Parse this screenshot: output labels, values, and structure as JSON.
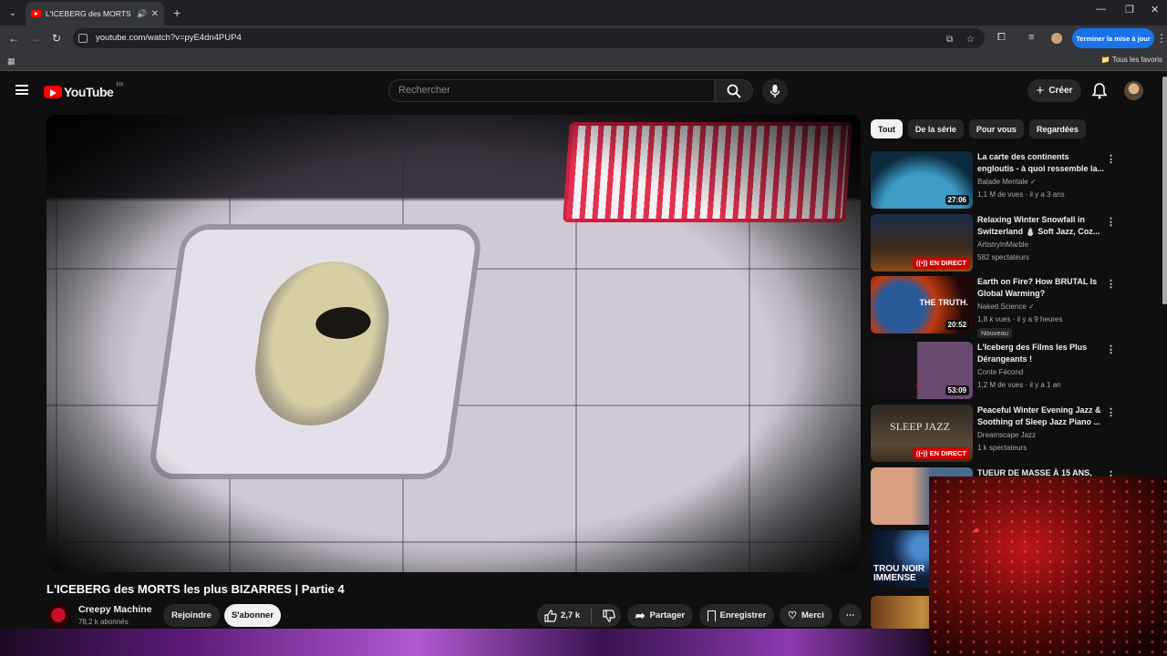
{
  "browser": {
    "tab_title": "L'ICEBERG des MORTS les p",
    "url": "youtube.com/watch?v=pyE4dn4PUP4",
    "update_button": "Terminer la mise à jour",
    "bookmarks_all": "Tous les favoris"
  },
  "youtube": {
    "logo_text": "YouTube",
    "country_code": "FR",
    "search_placeholder": "Rechercher",
    "create_label": "Créer"
  },
  "video": {
    "title": "L'ICEBERG des MORTS les plus BIZARRES | Partie 4",
    "channel": "Creepy Machine",
    "subscribers": "78,2 k abonnés",
    "join_label": "Rejoindre",
    "subscribe_label": "S'abonner",
    "likes": "2,7 k",
    "share_label": "Partager",
    "save_label": "Enregistrer",
    "thanks_label": "Merci"
  },
  "chips": [
    "Tout",
    "De la série",
    "Pour vous",
    "Regardées"
  ],
  "recommendations": [
    {
      "title": "La carte des continents engloutis - à quoi ressemble la...",
      "channel": "Balade Mentale ✓",
      "meta": "1,1 M de vues · il y a 3 ans",
      "duration": "27:06",
      "thumb_color": "#1e6f8a"
    },
    {
      "title": "Relaxing Winter Snowfall in Switzerland ⛄ Soft Jazz, Coz...",
      "channel": "ArtistryInMarble",
      "meta": "582 spectateurs",
      "live": "EN DIRECT",
      "thumb_color": "#203a5a"
    },
    {
      "title": "Earth on Fire? How BRUTAL Is Global Warming?",
      "channel": "Naked Science ✓",
      "meta": "1,8 k vues · il y a 9 heures",
      "duration": "20:52",
      "badge": "Nouveau",
      "overlay": "THE TRUTH.",
      "thumb_color": "#7a1f10"
    },
    {
      "title": "L'Iceberg des Films les Plus Dérangeants !",
      "channel": "Conte Fécond",
      "meta": "1,2 M de vues · il y a 1 an",
      "duration": "53:09",
      "thumb_color": "#3a2030"
    },
    {
      "title": "Peaceful Winter Evening Jazz & Soothing of Sleep Jazz Piano ...",
      "channel": "Dreamscape Jazz",
      "meta": "1 k spectateurs",
      "live": "EN DIRECT",
      "overlay": "SLEEP JAZZ",
      "thumb_color": "#2e2a25"
    },
    {
      "title": "TUEUR DE MASSE À 15 ANS,",
      "thumb_color": "#4a6b8a"
    }
  ],
  "extra_thumbs": [
    {
      "overlay": "TROU NOIR IMMENSE",
      "thumb_color": "#10213f"
    },
    {
      "thumb_color": "#a06a30"
    }
  ]
}
